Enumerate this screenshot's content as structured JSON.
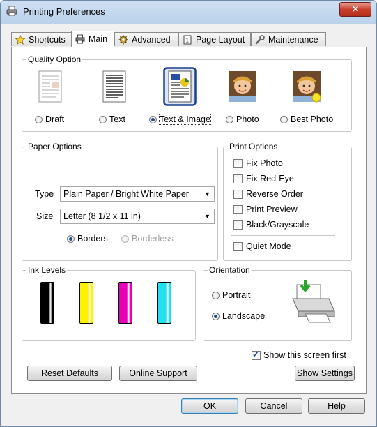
{
  "window": {
    "title": "Printing Preferences",
    "close_label": "✕"
  },
  "tabs": [
    {
      "label": "Shortcuts",
      "icon": "star-icon"
    },
    {
      "label": "Main",
      "icon": "printer-icon"
    },
    {
      "label": "Advanced",
      "icon": "gear-icon"
    },
    {
      "label": "Page Layout",
      "icon": "page-icon"
    },
    {
      "label": "Maintenance",
      "icon": "wrench-icon"
    }
  ],
  "quality": {
    "label": "Quality Option",
    "options": [
      {
        "label": "Draft",
        "selected": false
      },
      {
        "label": "Text",
        "selected": false
      },
      {
        "label": "Text & Image",
        "selected": true
      },
      {
        "label": "Photo",
        "selected": false
      },
      {
        "label": "Best Photo",
        "selected": false
      }
    ]
  },
  "paper": {
    "label": "Paper Options",
    "type_label": "Type",
    "type_value": "Plain Paper / Bright White Paper",
    "size_label": "Size",
    "size_value": "Letter (8 1/2 x 11 in)",
    "borders_label": "Borders",
    "borderless_label": "Borderless"
  },
  "print_options": {
    "label": "Print Options",
    "items": [
      {
        "label": "Fix Photo",
        "checked": false
      },
      {
        "label": "Fix Red-Eye",
        "checked": false
      },
      {
        "label": "Reverse Order",
        "checked": false
      },
      {
        "label": "Print Preview",
        "checked": false
      },
      {
        "label": "Black/Grayscale",
        "checked": false
      }
    ],
    "quiet_mode": "Quiet Mode"
  },
  "ink": {
    "label": "Ink Levels",
    "colors": [
      "#000000",
      "#fff200",
      "#e600b8",
      "#22e0ee"
    ]
  },
  "orientation": {
    "label": "Orientation",
    "portrait": "Portrait",
    "landscape": "Landscape",
    "selected": "Landscape"
  },
  "show_first": "Show this screen first",
  "buttons": {
    "reset": "Reset Defaults",
    "online": "Online Support",
    "show_settings": "Show Settings",
    "ok": "OK",
    "cancel": "Cancel",
    "help": "Help"
  }
}
